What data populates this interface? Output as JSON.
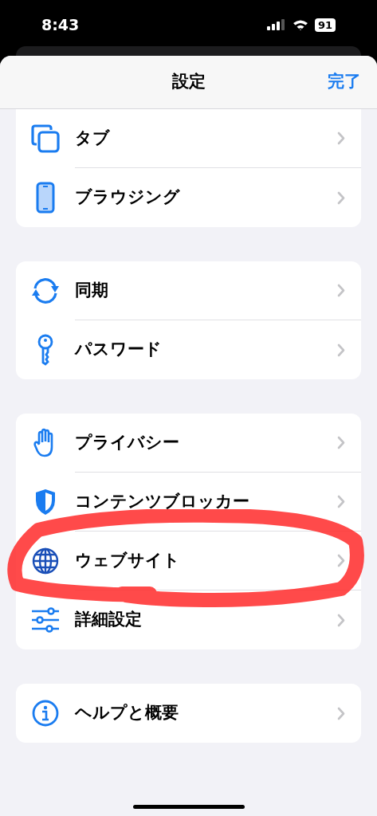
{
  "status_bar": {
    "time": "8:43",
    "battery": "91"
  },
  "header": {
    "title": "設定",
    "done": "完了"
  },
  "groups": [
    {
      "items": [
        {
          "label": "タブ",
          "circled": false
        },
        {
          "label": "ブラウジング",
          "circled": false
        }
      ]
    },
    {
      "items": [
        {
          "label": "同期",
          "circled": false
        },
        {
          "label": "パスワード",
          "circled": false
        }
      ]
    },
    {
      "items": [
        {
          "label": "プライバシー",
          "circled": false
        },
        {
          "label": "コンテンツブロッカー",
          "circled": false
        },
        {
          "label": "ウェブサイト",
          "circled": true
        },
        {
          "label": "詳細設定",
          "circled": false
        }
      ]
    },
    {
      "items": [
        {
          "label": "ヘルプと概要",
          "circled": false
        }
      ]
    }
  ]
}
